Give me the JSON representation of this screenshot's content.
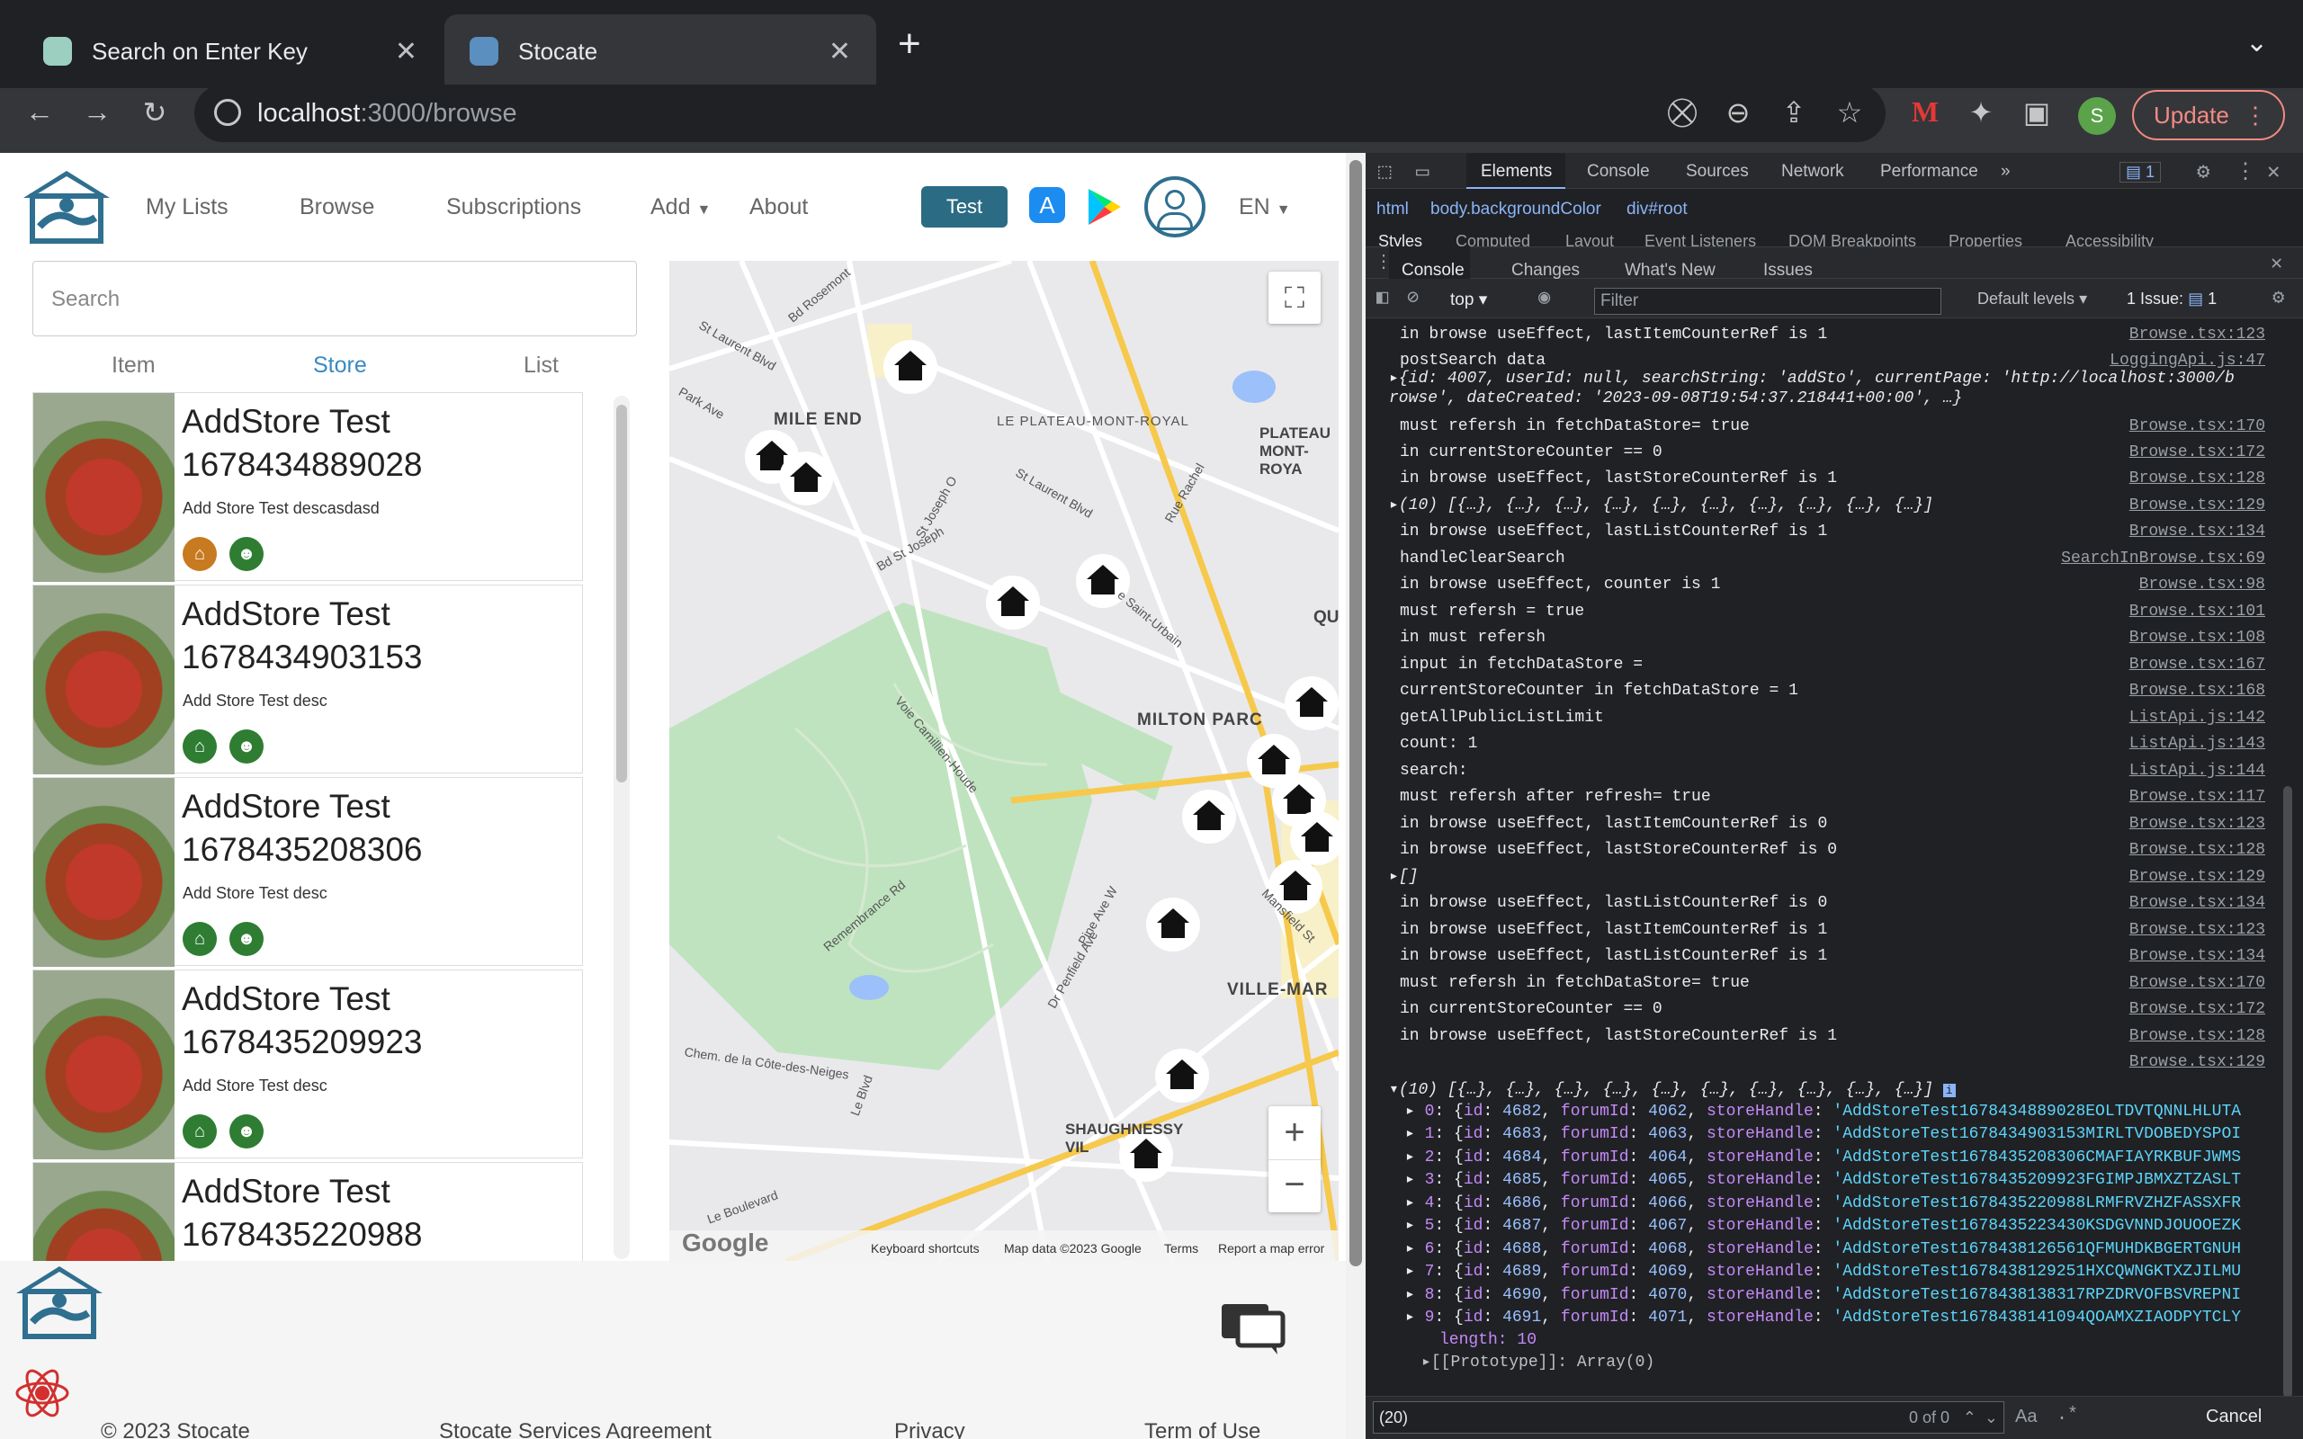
{
  "browser": {
    "tabs": [
      {
        "title": "Search on Enter Key",
        "active": false
      },
      {
        "title": "Stocate",
        "active": true
      }
    ],
    "url_host": "localhost",
    "url_rest": ":3000/browse",
    "update_label": "Update",
    "profile_initial": "S"
  },
  "site": {
    "nav": [
      "My Lists",
      "Browse",
      "Subscriptions",
      "Add",
      "About"
    ],
    "test_label": "Test",
    "lang": "EN",
    "search_placeholder": "Search",
    "subtabs": [
      "Item",
      "Store",
      "List"
    ],
    "active_subtab": "Store",
    "stores": [
      {
        "name": "AddStore Test",
        "id": "1678434889028",
        "desc": "Add Store Test descasdasd",
        "icon_color": "#c77a1f"
      },
      {
        "name": "AddStore Test",
        "id": "1678434903153",
        "desc": "Add Store Test desc",
        "icon_color": "#2e7d32"
      },
      {
        "name": "AddStore Test",
        "id": "1678435208306",
        "desc": "Add Store Test desc",
        "icon_color": "#2e7d32"
      },
      {
        "name": "AddStore Test",
        "id": "1678435209923",
        "desc": "Add Store Test desc",
        "icon_color": "#2e7d32"
      },
      {
        "name": "AddStore Test",
        "id": "1678435220988",
        "desc": "",
        "icon_color": "#2e7d32"
      }
    ],
    "map_labels": [
      "MILE END",
      "LE PLATEAU-MONT-ROYAL",
      "PLATEAU MONT-ROYA",
      "MILTON PARC",
      "VILLE-MAR",
      "SHAUGHNESSY VIL",
      "St Laurent Blvd",
      "Bd Rosemont",
      "Park Ave",
      "Voie Camillien-Houde",
      "Remembrance Rd",
      "Pine Ave W",
      "Dr Penfield Ave",
      "Mansfield St",
      "Chem. de la Côte-des-Neiges",
      "Le Boulevard",
      "Rue Rachel",
      "e Saint-Urbain",
      "QU",
      "Le Blvd",
      "St Joseph O",
      "Bd St Joseph",
      "St Laurent Blvd"
    ],
    "map_footer": [
      "Keyboard shortcuts",
      "Map data ©2023 Google",
      "Terms",
      "Report a map error"
    ],
    "map_logo": "Google",
    "footer_links": [
      "© 2023 Stocate",
      "Stocate Services Agreement",
      "Privacy",
      "Term of Use"
    ]
  },
  "devtools": {
    "tabs": [
      "Elements",
      "Console",
      "Sources",
      "Network",
      "Performance"
    ],
    "issues_badge": "1",
    "breadcrumb": [
      "html",
      "body.backgroundColor",
      "div#root"
    ],
    "styles_tabs": [
      "Styles",
      "Computed",
      "Layout",
      "Event Listeners",
      "DOM Breakpoints",
      "Properties",
      "Accessibility"
    ],
    "drawer_tabs": [
      "Console",
      "Changes",
      "What's New",
      "Issues"
    ],
    "context": "top",
    "filter_placeholder": "Filter",
    "levels": "Default levels",
    "issue_label": "1 Issue:",
    "issue_count": "1",
    "logs": [
      {
        "msg": "in browse useEffect, lastItemCounterRef is 1",
        "src": "Browse.tsx:123"
      },
      {
        "msg": "postSearch data",
        "src": "LoggingApi.js:47"
      },
      {
        "msg": "▸{id: 4007, userId: null, searchString: 'addSto', currentPage: 'http://localhost:3000/b",
        "src": ""
      },
      {
        "msg": "  rowse', dateCreated: '2023-09-08T19:54:37.218441+00:00', …}",
        "src": ""
      },
      {
        "msg": "must refersh in fetchDataStore= true",
        "src": "Browse.tsx:170"
      },
      {
        "msg": "in currentStoreCounter == 0",
        "src": "Browse.tsx:172"
      },
      {
        "msg": "in browse useEffect, lastStoreCounterRef is 1",
        "src": "Browse.tsx:128"
      },
      {
        "msg": "▸(10) [{…}, {…}, {…}, {…}, {…}, {…}, {…}, {…}, {…}, {…}]",
        "src": "Browse.tsx:129"
      },
      {
        "msg": "in browse useEffect, lastListCounterRef is 1",
        "src": "Browse.tsx:134"
      },
      {
        "msg": "handleClearSearch",
        "src": "SearchInBrowse.tsx:69"
      },
      {
        "msg": "in browse useEffect, counter is 1",
        "src": "Browse.tsx:98"
      },
      {
        "msg": "must refersh = true",
        "src": "Browse.tsx:101"
      },
      {
        "msg": "in must refersh",
        "src": "Browse.tsx:108"
      },
      {
        "msg": "input in fetchDataStore =",
        "src": "Browse.tsx:167"
      },
      {
        "msg": "currentStoreCounter in fetchDataStore = 1",
        "src": "Browse.tsx:168"
      },
      {
        "msg": "getAllPublicListLimit",
        "src": "ListApi.js:142"
      },
      {
        "msg": "count: 1",
        "src": "ListApi.js:143"
      },
      {
        "msg": "search:",
        "src": "ListApi.js:144"
      },
      {
        "msg": "must refersh after refresh= true",
        "src": "Browse.tsx:117"
      },
      {
        "msg": "in browse useEffect, lastItemCounterRef is 0",
        "src": "Browse.tsx:123"
      },
      {
        "msg": "in browse useEffect, lastStoreCounterRef is 0",
        "src": "Browse.tsx:128"
      },
      {
        "msg": "▸[]",
        "src": "Browse.tsx:129"
      },
      {
        "msg": "in browse useEffect, lastListCounterRef is 0",
        "src": "Browse.tsx:134"
      },
      {
        "msg": "in browse useEffect, lastItemCounterRef is 1",
        "src": "Browse.tsx:123"
      },
      {
        "msg": "in browse useEffect, lastListCounterRef is 1",
        "src": "Browse.tsx:134"
      },
      {
        "msg": "must refersh in fetchDataStore= true",
        "src": "Browse.tsx:170"
      },
      {
        "msg": "in currentStoreCounter == 0",
        "src": "Browse.tsx:172"
      },
      {
        "msg": "in browse useEffect, lastStoreCounterRef is 1",
        "src": "Browse.tsx:128"
      },
      {
        "msg": "",
        "src": "Browse.tsx:129"
      }
    ],
    "array_header": "▾(10) [{…}, {…}, {…}, {…}, {…}, {…}, {…}, {…}, {…}, {…}]",
    "array_items": [
      {
        "i": "0",
        "id": "4682",
        "forum": "4062",
        "handle": "'AddStoreTest1678434889028EOLTDVTQNNLHLUTA"
      },
      {
        "i": "1",
        "id": "4683",
        "forum": "4063",
        "handle": "'AddStoreTest1678434903153MIRLTVDOBEDYSPOI"
      },
      {
        "i": "2",
        "id": "4684",
        "forum": "4064",
        "handle": "'AddStoreTest1678435208306CMAFIAYRKBUFJWMS"
      },
      {
        "i": "3",
        "id": "4685",
        "forum": "4065",
        "handle": "'AddStoreTest1678435209923FGIMPJBMXZTZASLT"
      },
      {
        "i": "4",
        "id": "4686",
        "forum": "4066",
        "handle": "'AddStoreTest1678435220988LRMFRVZHZFASSXFR"
      },
      {
        "i": "5",
        "id": "4687",
        "forum": "4067",
        "handle": "'AddStoreTest1678435223430KSDGVNNDJOUOOEZK"
      },
      {
        "i": "6",
        "id": "4688",
        "forum": "4068",
        "handle": "'AddStoreTest1678438126561QFMUHDKBGERTGNUH"
      },
      {
        "i": "7",
        "id": "4689",
        "forum": "4069",
        "handle": "'AddStoreTest1678438129251HXCQWNGKTXZJILMU"
      },
      {
        "i": "8",
        "id": "4690",
        "forum": "4070",
        "handle": "'AddStoreTest1678438138317RPZDRVOFBSVREPNI"
      },
      {
        "i": "9",
        "id": "4691",
        "forum": "4071",
        "handle": "'AddStoreTest1678438141094QOAMXZIAODPYTCLY"
      }
    ],
    "length_label": "length: 10",
    "proto_label": "▸[[Prototype]]: Array(0)",
    "find_value": "(20)",
    "find_count": "0 of 0",
    "aa_label": "Aa",
    "cancel_label": "Cancel"
  }
}
